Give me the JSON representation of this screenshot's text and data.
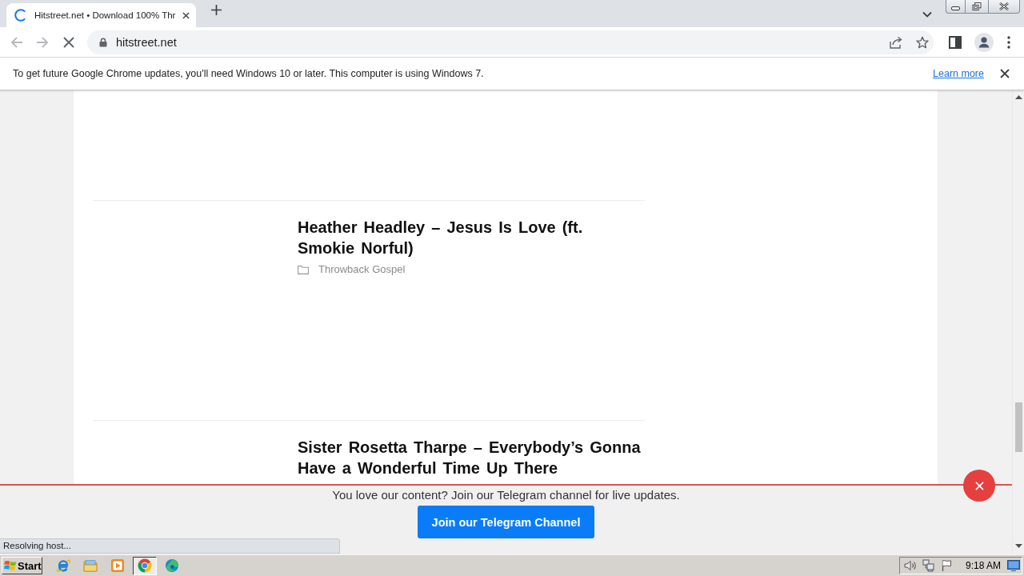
{
  "browser": {
    "tabs": [
      {
        "title": "Hitstreet.net • Download 100% Thr",
        "selected": true,
        "loading": true
      }
    ],
    "toolbar": {
      "url": "hitstreet.net",
      "loading": true
    },
    "infobar": {
      "message": "To get future Google Chrome updates, you'll need Windows 10 or later. This computer is using Windows 7.",
      "link": "Learn more"
    },
    "status": "Resolving host..."
  },
  "page": {
    "posts": [
      {
        "title": "Heather Headley – Jesus Is Love (ft. Smokie Norful)",
        "category": "Throwback Gospel"
      },
      {
        "title": "Sister Rosetta Tharpe – Everybody’s Gonna Have a Wonderful Time Up There"
      }
    ],
    "subscribe_bar": {
      "message": "You love our content? Join our Telegram channel for live updates.",
      "button": "Join our Telegram Channel"
    }
  },
  "taskbar": {
    "start": "Start",
    "apps": [
      {
        "kind": "ie",
        "selected": false
      },
      {
        "kind": "explorer",
        "selected": false
      },
      {
        "kind": "media",
        "selected": false
      },
      {
        "kind": "chrome",
        "selected": true
      },
      {
        "kind": "edge",
        "selected": false
      }
    ],
    "clock": "9:18 AM"
  }
}
